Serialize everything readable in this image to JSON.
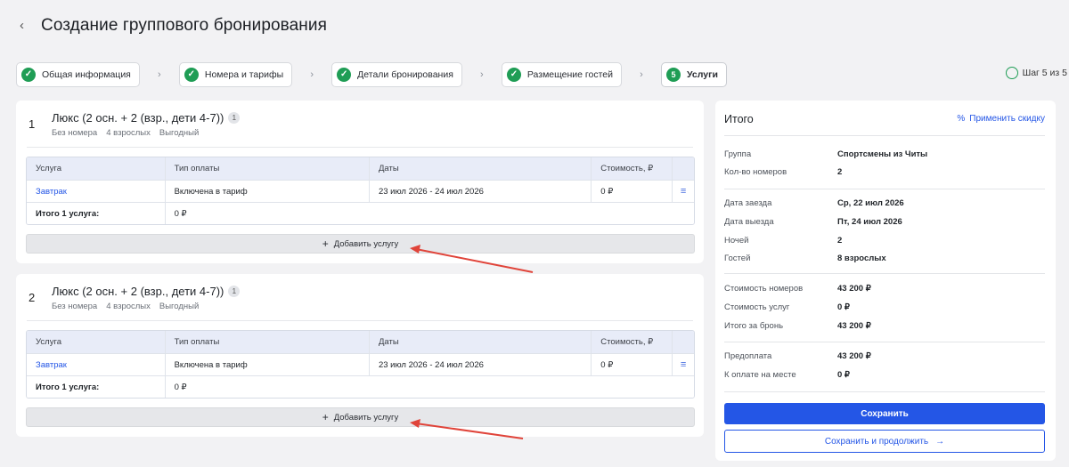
{
  "page": {
    "title": "Создание группового бронирования",
    "back_icon": "‹"
  },
  "stepper": {
    "steps": [
      {
        "label": "Общая информация",
        "state": "done"
      },
      {
        "label": "Номера и тарифы",
        "state": "done"
      },
      {
        "label": "Детали бронирования",
        "state": "done"
      },
      {
        "label": "Размещение гостей",
        "state": "done"
      },
      {
        "label": "Услуги",
        "state": "active",
        "number": "5"
      }
    ],
    "progress_label": "Шаг 5 из 5"
  },
  "rooms": [
    {
      "number": "1",
      "name": "Люкс (2 осн. + 2 (взр., дети 4-7))",
      "badge": "1",
      "meta": [
        "Без номера",
        "4 взрослых",
        "Выгодный"
      ],
      "table": {
        "headers": [
          "Услуга",
          "Тип оплаты",
          "Даты",
          "Стоимость, ₽"
        ],
        "rows": [
          {
            "service": "Завтрак",
            "payment": "Включена в тариф",
            "dates": "23 июл 2026 - 24 июл 2026",
            "cost": "0 ₽"
          }
        ],
        "total_label": "Итого 1 услуга:",
        "total_value": "0 ₽"
      },
      "add_label": "Добавить услугу"
    },
    {
      "number": "2",
      "name": "Люкс (2 осн. + 2 (взр., дети 4-7))",
      "badge": "1",
      "meta": [
        "Без номера",
        "4 взрослых",
        "Выгодный"
      ],
      "table": {
        "headers": [
          "Услуга",
          "Тип оплаты",
          "Даты",
          "Стоимость, ₽"
        ],
        "rows": [
          {
            "service": "Завтрак",
            "payment": "Включена в тариф",
            "dates": "23 июл 2026 - 24 июл 2026",
            "cost": "0 ₽"
          }
        ],
        "total_label": "Итого 1 услуга:",
        "total_value": "0 ₽"
      },
      "add_label": "Добавить услугу"
    }
  ],
  "summary": {
    "title": "Итого",
    "discount_label": "Применить скидку",
    "group_label": "Группа",
    "group_value": "Спортсмены из Читы",
    "rooms_count_label": "Кол-во номеров",
    "rooms_count_value": "2",
    "checkin_label": "Дата заезда",
    "checkin_value": "Ср, 22 июл 2026",
    "checkout_label": "Дата выезда",
    "checkout_value": "Пт, 24 июл 2026",
    "nights_label": "Ночей",
    "nights_value": "2",
    "guests_label": "Гостей",
    "guests_value": "8 взрослых",
    "rooms_cost_label": "Стоимость номеров",
    "rooms_cost_value": "43 200 ₽",
    "services_cost_label": "Стоимость услуг",
    "services_cost_value": "0 ₽",
    "total_label": "Итого за бронь",
    "total_value": "43 200 ₽",
    "prepay_label": "Предоплата",
    "prepay_value": "43 200 ₽",
    "onsite_label": "К оплате на месте",
    "onsite_value": "0 ₽",
    "save_label": "Сохранить",
    "save_continue_label": "Сохранить и продолжить"
  },
  "colors": {
    "accent": "#2456e6",
    "success": "#1f9d55",
    "annotation_arrow": "#e0443a"
  }
}
